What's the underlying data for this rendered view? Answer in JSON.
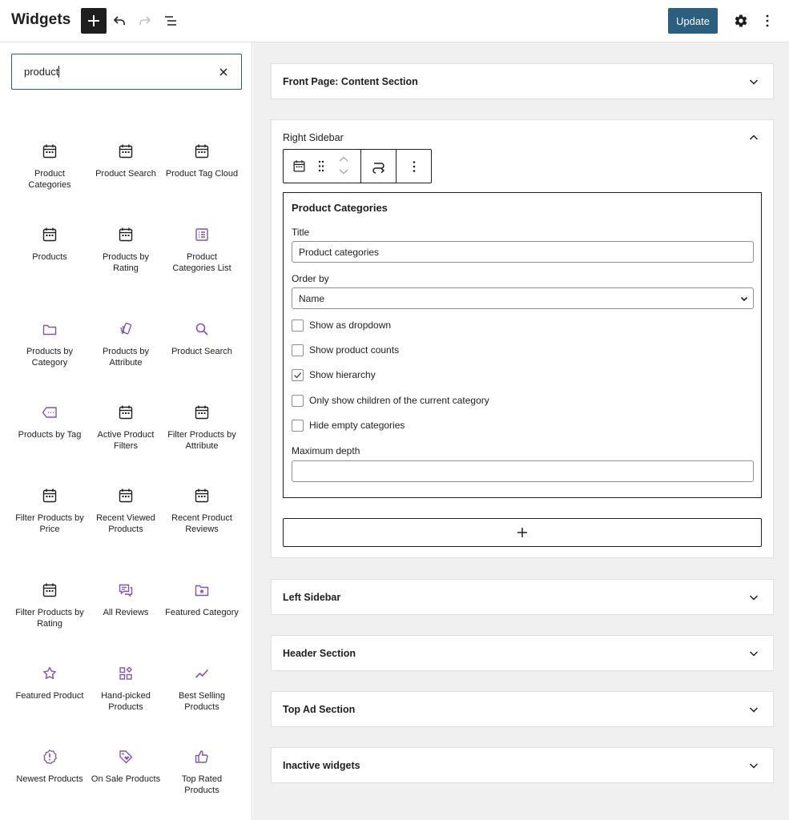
{
  "header": {
    "title": "Widgets",
    "update_label": "Update",
    "icons": [
      "plus-icon",
      "undo-icon",
      "redo-icon",
      "list-view-icon",
      "gear-icon",
      "more-vertical-icon"
    ]
  },
  "inserter": {
    "search_value": "product",
    "blocks": [
      {
        "label": "Product Categories",
        "icon": "calendar-icon"
      },
      {
        "label": "Product Search",
        "icon": "calendar-icon"
      },
      {
        "label": "Product Tag Cloud",
        "icon": "calendar-icon"
      },
      {
        "label": "Products",
        "icon": "calendar-icon"
      },
      {
        "label": "Products by Rating",
        "icon": "calendar-icon"
      },
      {
        "label": "Product Categories List",
        "icon": "list-icon"
      },
      {
        "label": "Products by Category",
        "icon": "folder-icon"
      },
      {
        "label": "Products by Attribute",
        "icon": "attribute-icon"
      },
      {
        "label": "Product Search",
        "icon": "search-icon"
      },
      {
        "label": "Products by Tag",
        "icon": "tag-icon"
      },
      {
        "label": "Active Product Filters",
        "icon": "calendar-icon"
      },
      {
        "label": "Filter Products by Attribute",
        "icon": "calendar-icon"
      },
      {
        "label": "Filter Products by Price",
        "icon": "calendar-icon"
      },
      {
        "label": "Recent Viewed Products",
        "icon": "calendar-icon"
      },
      {
        "label": "Recent Product Reviews",
        "icon": "calendar-icon"
      },
      {
        "label": "Filter Products by Rating",
        "icon": "calendar-icon"
      },
      {
        "label": "All Reviews",
        "icon": "comments-icon"
      },
      {
        "label": "Featured Category",
        "icon": "folder-star-icon"
      },
      {
        "label": "Featured Product",
        "icon": "star-icon"
      },
      {
        "label": "Hand-picked Products",
        "icon": "grid-icon"
      },
      {
        "label": "Best Selling Products",
        "icon": "trend-icon"
      },
      {
        "label": "Newest Products",
        "icon": "badge-icon"
      },
      {
        "label": "On Sale Products",
        "icon": "sale-tag-icon"
      },
      {
        "label": "Top Rated Products",
        "icon": "thumbs-up-icon"
      }
    ]
  },
  "areas": {
    "front_page": "Front Page: Content Section",
    "right_sidebar": "Right Sidebar",
    "left_sidebar": "Left Sidebar",
    "header_section": "Header Section",
    "top_ad": "Top Ad Section",
    "inactive": "Inactive widgets"
  },
  "widget_form": {
    "heading": "Product Categories",
    "title_label": "Title",
    "title_value": "Product categories",
    "orderby_label": "Order by",
    "orderby_value": "Name",
    "options": [
      {
        "label": "Show as dropdown",
        "checked": false
      },
      {
        "label": "Show product counts",
        "checked": false
      },
      {
        "label": "Show hierarchy",
        "checked": true
      },
      {
        "label": "Only show children of the current category",
        "checked": false
      },
      {
        "label": "Hide empty categories",
        "checked": false
      }
    ],
    "max_depth_label": "Maximum depth",
    "max_depth_value": ""
  },
  "colors": {
    "accent": "#2b5f7f",
    "icon_purple": "#7f54b3",
    "canvas_bg": "#f0f0f0"
  }
}
